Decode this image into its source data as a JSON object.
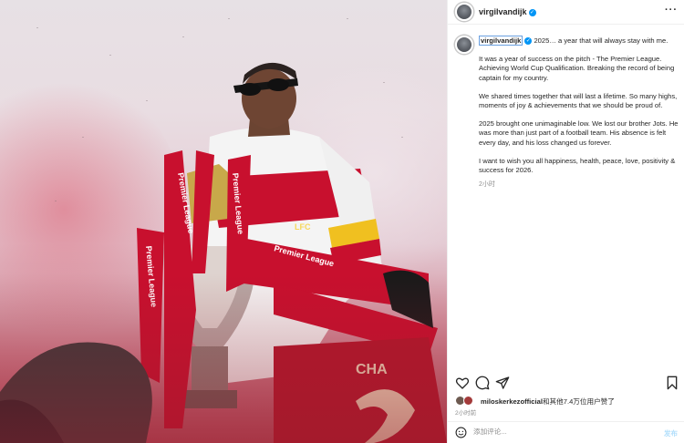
{
  "post": {
    "username": "virgilvandijk",
    "verified_icon": "verified-badge-icon",
    "more_icon": "ellipsis-icon"
  },
  "caption": {
    "username": "virgilvandijk",
    "first_line": "2025… a year that will always stay with me.",
    "paragraphs": [
      "It was a year of success on the pitch - The Premier League. Achieving World Cup Qualification. Breaking the record of being captain for my country.",
      "We shared times together that will last a lifetime. So many highs, moments of joy & achievements that we should be proud of.",
      "2025 brought one unimaginable low. We lost our brother Jots. He was more than just part of a football team. His absence is felt every day, and his loss changed us forever.",
      "I want to wish you all happiness, health, peace, love, positivity & success for 2026."
    ],
    "time": "2小时"
  },
  "actions": {
    "like_icon": "heart-icon",
    "comment_icon": "comment-icon",
    "share_icon": "send-icon",
    "save_icon": "bookmark-icon"
  },
  "likes": {
    "user": "miloskerkezofficial",
    "text": "和其他7.4万位用户赞了"
  },
  "post_time": "2小时前",
  "comment": {
    "placeholder": "添加评论...",
    "post_label": "发布",
    "emoji_icon": "smiley-icon"
  },
  "colors": {
    "accent_blue": "#0095f6",
    "liverpool_red": "#c8102e"
  }
}
